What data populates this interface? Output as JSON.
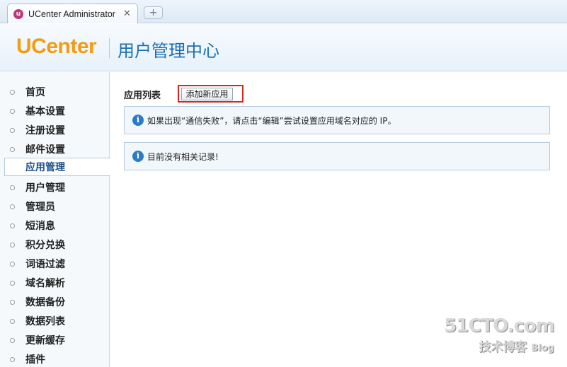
{
  "browser": {
    "tab_title": "UCenter Administrator",
    "tab_icon": "ucenter-favicon",
    "close_glyph": "✕",
    "new_tab_glyph": "+"
  },
  "header": {
    "logo": "UCenter",
    "subtitle": "用户管理中心"
  },
  "sidebar": {
    "items": [
      {
        "label": "首页",
        "active": false
      },
      {
        "label": "基本设置",
        "active": false
      },
      {
        "label": "注册设置",
        "active": false
      },
      {
        "label": "邮件设置",
        "active": false
      },
      {
        "label": "应用管理",
        "active": true
      },
      {
        "label": "用户管理",
        "active": false
      },
      {
        "label": "管理员",
        "active": false
      },
      {
        "label": "短消息",
        "active": false
      },
      {
        "label": "积分兑换",
        "active": false
      },
      {
        "label": "词语过滤",
        "active": false
      },
      {
        "label": "域名解析",
        "active": false
      },
      {
        "label": "数据备份",
        "active": false
      },
      {
        "label": "数据列表",
        "active": false
      },
      {
        "label": "更新缓存",
        "active": false
      },
      {
        "label": "插件",
        "active": false
      }
    ]
  },
  "main": {
    "section_title": "应用列表",
    "add_button_label": "添加新应用",
    "notices": [
      {
        "icon": "info-icon",
        "text": "如果出现“通信失败”，请点击“编辑”尝试设置应用域名对应的 IP。"
      },
      {
        "icon": "info-icon",
        "text": "目前没有相关记录!"
      }
    ]
  },
  "watermark": {
    "site": "51CTO.com",
    "tagline": "技术博客",
    "blog": "Blog"
  },
  "colors": {
    "logo_orange": "#f39c12",
    "title_blue": "#1a6fb5",
    "highlight_red": "#d9261c",
    "info_blue": "#2b7bc7"
  }
}
